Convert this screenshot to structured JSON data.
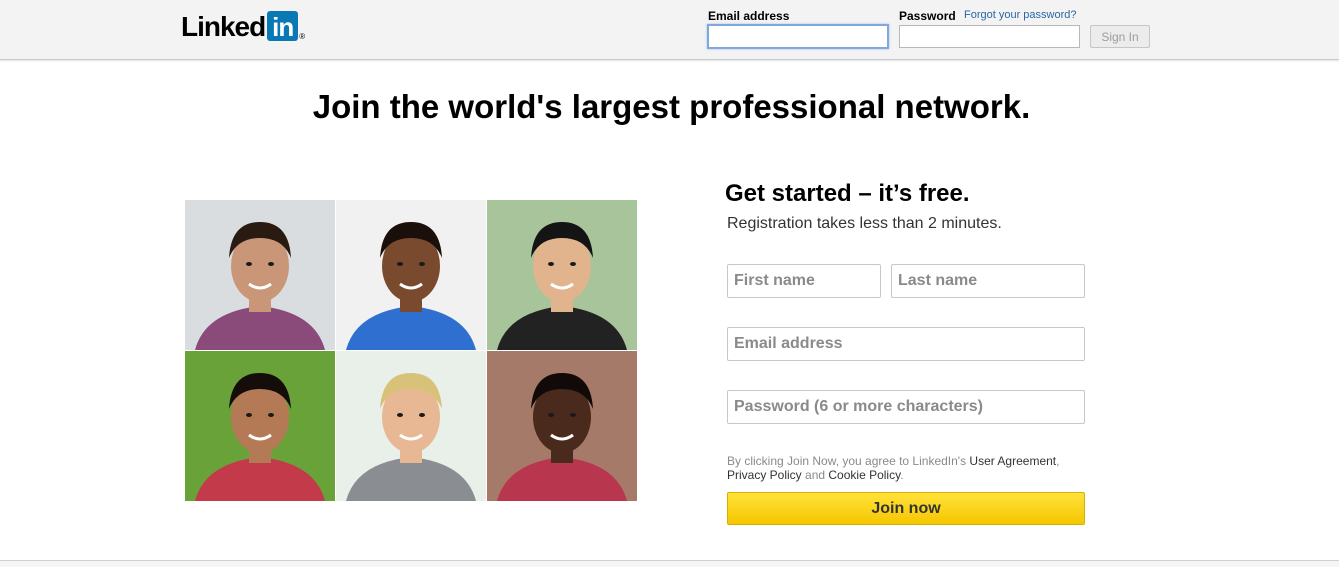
{
  "header": {
    "logo_text": "Linked",
    "logo_box_text": "in",
    "logo_reg": "®",
    "email_label": "Email address",
    "password_label": "Password",
    "forgot_link": "Forgot your password?",
    "email_value": "",
    "password_value": "",
    "signin_label": "Sign In"
  },
  "headline": "Join the world's largest professional network.",
  "photos": [
    {
      "name": "member-photo-1",
      "bg": "#d9dde0",
      "skin": "#c99778",
      "hair": "#2a1b12",
      "shirt": "#8a4a7a"
    },
    {
      "name": "member-photo-2",
      "bg": "#f1f1f1",
      "skin": "#7a4a2e",
      "hair": "#1a0f0a",
      "shirt": "#2f6fcf"
    },
    {
      "name": "member-photo-3",
      "bg": "#a8c49a",
      "skin": "#e2b48e",
      "hair": "#141414",
      "shirt": "#222222"
    },
    {
      "name": "member-photo-4",
      "bg": "#6aa23a",
      "skin": "#b47a55",
      "hair": "#150d0a",
      "shirt": "#c33a4a"
    },
    {
      "name": "member-photo-5",
      "bg": "#e9efe9",
      "skin": "#e8b895",
      "hair": "#d8c27a",
      "shirt": "#8a8e93"
    },
    {
      "name": "member-photo-6",
      "bg": "#a67a68",
      "skin": "#4a2a1c",
      "hair": "#120a08",
      "shirt": "#b8364e"
    }
  ],
  "form": {
    "title": "Get started – it’s free.",
    "subtitle": "Registration takes less than 2 minutes.",
    "first_name_placeholder": "First name",
    "last_name_placeholder": "Last name",
    "email_placeholder": "Email address",
    "password_placeholder": "Password (6 or more characters)",
    "terms_prefix": "By clicking Join Now, you agree to LinkedIn's ",
    "user_agreement": "User Agreement",
    "comma": ",",
    "privacy_policy": "Privacy Policy",
    "and": " and ",
    "cookie_policy": "Cookie Policy",
    "period": ".",
    "join_label": "Join now"
  },
  "colors": {
    "brand_blue": "#0a78b5",
    "join_yellow": "#f6c600",
    "link_blue": "#2a66a6"
  }
}
